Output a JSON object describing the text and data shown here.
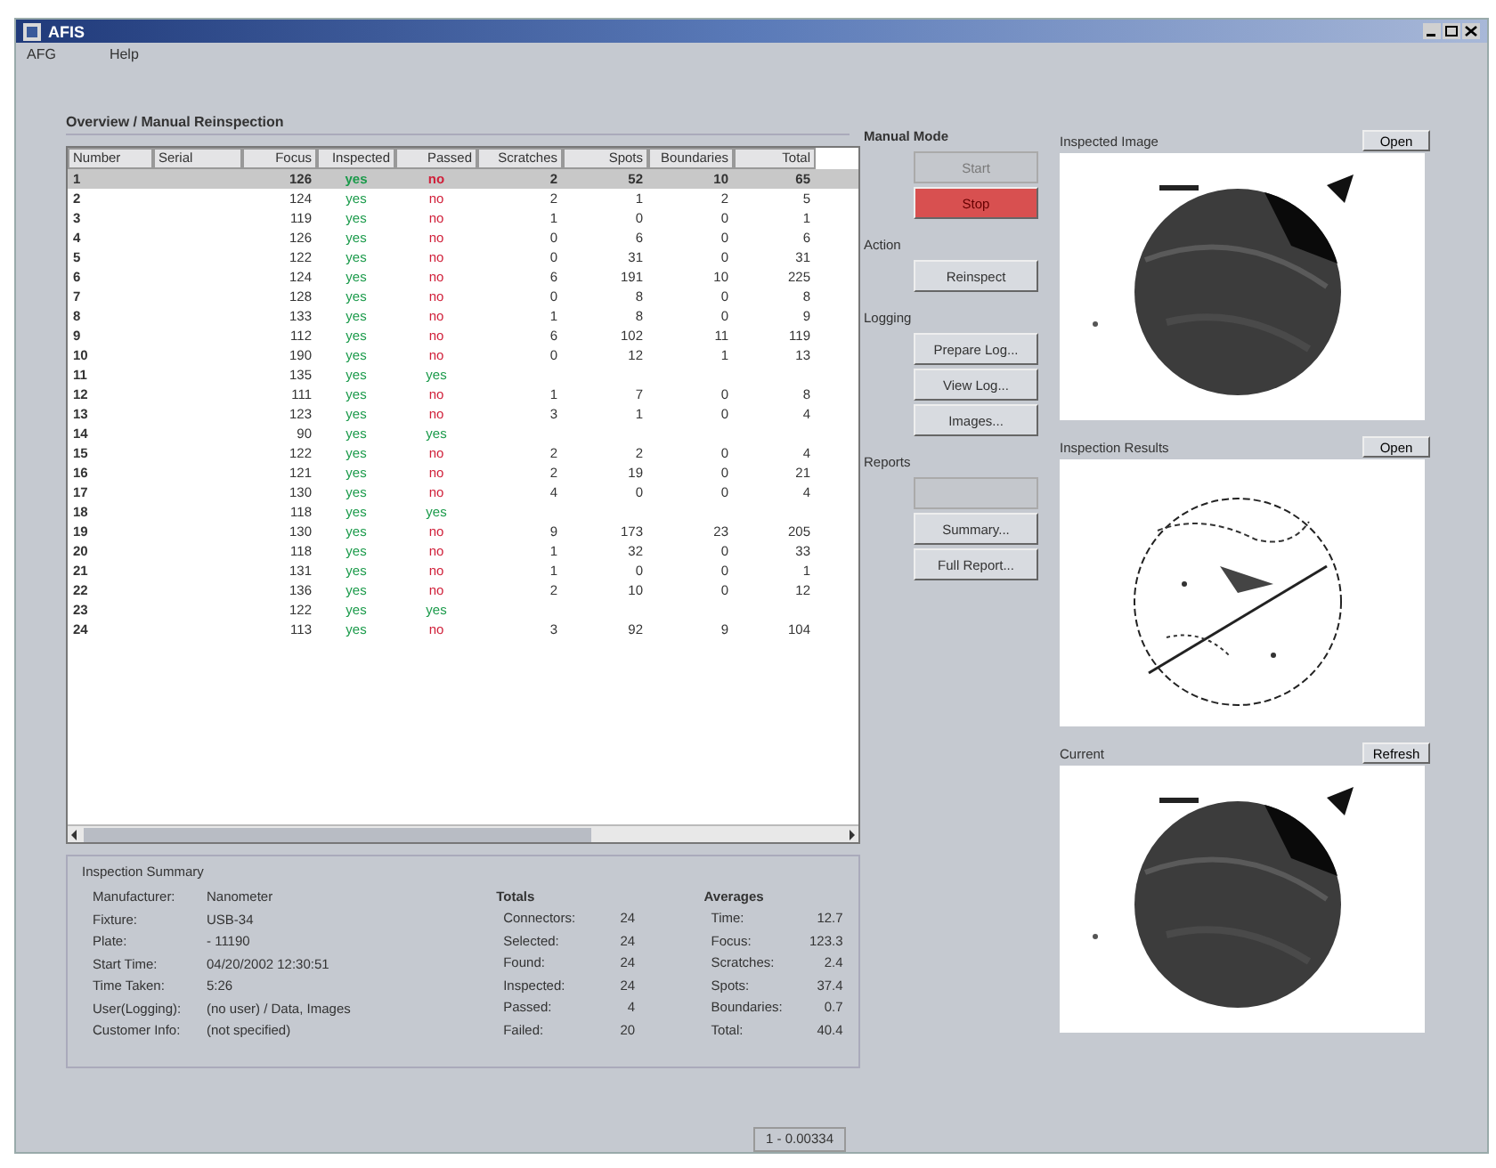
{
  "window": {
    "title": "AFIS"
  },
  "menu": [
    "AFG",
    "Help"
  ],
  "breadcrumb": "Overview / Manual Reinspection",
  "table": {
    "columns": [
      "Number",
      "Serial",
      "Focus",
      "Inspected",
      "Passed",
      "Scratches",
      "Spots",
      "Boundaries",
      "Total"
    ],
    "rows": [
      {
        "number": "1",
        "focus": "126",
        "inspected": {
          "text": "yes",
          "ok": true
        },
        "passed": {
          "text": "no",
          "ok": false
        },
        "scratches": "2",
        "spots": "52",
        "boundaries": "10",
        "total": "65",
        "selected": true
      },
      {
        "number": "2",
        "focus": "124",
        "inspected": {
          "text": "yes",
          "ok": true
        },
        "passed": {
          "text": "no",
          "ok": false
        },
        "scratches": "2",
        "spots": "1",
        "boundaries": "2",
        "total": "5",
        "selected": false
      },
      {
        "number": "3",
        "focus": "119",
        "inspected": {
          "text": "yes",
          "ok": true
        },
        "passed": {
          "text": "no",
          "ok": false
        },
        "scratches": "1",
        "spots": "0",
        "boundaries": "0",
        "total": "1",
        "selected": false
      },
      {
        "number": "4",
        "focus": "126",
        "inspected": {
          "text": "yes",
          "ok": true
        },
        "passed": {
          "text": "no",
          "ok": false
        },
        "scratches": "0",
        "spots": "6",
        "boundaries": "0",
        "total": "6",
        "selected": false
      },
      {
        "number": "5",
        "focus": "122",
        "inspected": {
          "text": "yes",
          "ok": true
        },
        "passed": {
          "text": "no",
          "ok": false
        },
        "scratches": "0",
        "spots": "31",
        "boundaries": "0",
        "total": "31",
        "selected": false
      },
      {
        "number": "6",
        "focus": "124",
        "inspected": {
          "text": "yes",
          "ok": true
        },
        "passed": {
          "text": "no",
          "ok": false
        },
        "scratches": "6",
        "spots": "191",
        "boundaries": "10",
        "total": "225",
        "selected": false
      },
      {
        "number": "7",
        "focus": "128",
        "inspected": {
          "text": "yes",
          "ok": true
        },
        "passed": {
          "text": "no",
          "ok": false
        },
        "scratches": "0",
        "spots": "8",
        "boundaries": "0",
        "total": "8",
        "selected": false
      },
      {
        "number": "8",
        "focus": "133",
        "inspected": {
          "text": "yes",
          "ok": true
        },
        "passed": {
          "text": "no",
          "ok": false
        },
        "scratches": "1",
        "spots": "8",
        "boundaries": "0",
        "total": "9",
        "selected": false
      },
      {
        "number": "9",
        "focus": "112",
        "inspected": {
          "text": "yes",
          "ok": true
        },
        "passed": {
          "text": "no",
          "ok": false
        },
        "scratches": "6",
        "spots": "102",
        "boundaries": "11",
        "total": "119",
        "selected": false
      },
      {
        "number": "10",
        "focus": "190",
        "inspected": {
          "text": "yes",
          "ok": true
        },
        "passed": {
          "text": "no",
          "ok": false
        },
        "scratches": "0",
        "spots": "12",
        "boundaries": "1",
        "total": "13",
        "selected": false
      },
      {
        "number": "11",
        "focus": "135",
        "inspected": {
          "text": "yes",
          "ok": true
        },
        "passed": {
          "text": "yes",
          "ok": true
        },
        "selected": false
      },
      {
        "number": "12",
        "focus": "111",
        "inspected": {
          "text": "yes",
          "ok": true
        },
        "passed": {
          "text": "no",
          "ok": false
        },
        "scratches": "1",
        "spots": "7",
        "boundaries": "0",
        "total": "8",
        "selected": false
      },
      {
        "number": "13",
        "focus": "123",
        "inspected": {
          "text": "yes",
          "ok": true
        },
        "passed": {
          "text": "no",
          "ok": false
        },
        "scratches": "3",
        "spots": "1",
        "boundaries": "0",
        "total": "4",
        "selected": false
      },
      {
        "number": "14",
        "focus": "90",
        "inspected": {
          "text": "yes",
          "ok": true
        },
        "passed": {
          "text": "yes",
          "ok": true
        },
        "selected": false
      },
      {
        "number": "15",
        "focus": "122",
        "inspected": {
          "text": "yes",
          "ok": true
        },
        "passed": {
          "text": "no",
          "ok": false
        },
        "scratches": "2",
        "spots": "2",
        "boundaries": "0",
        "total": "4",
        "selected": false
      },
      {
        "number": "16",
        "focus": "121",
        "inspected": {
          "text": "yes",
          "ok": true
        },
        "passed": {
          "text": "no",
          "ok": false
        },
        "scratches": "2",
        "spots": "19",
        "boundaries": "0",
        "total": "21",
        "selected": false
      },
      {
        "number": "17",
        "focus": "130",
        "inspected": {
          "text": "yes",
          "ok": true
        },
        "passed": {
          "text": "no",
          "ok": false
        },
        "scratches": "4",
        "spots": "0",
        "boundaries": "0",
        "total": "4",
        "selected": false
      },
      {
        "number": "18",
        "focus": "118",
        "inspected": {
          "text": "yes",
          "ok": true
        },
        "passed": {
          "text": "yes",
          "ok": true
        },
        "selected": false
      },
      {
        "number": "19",
        "focus": "130",
        "inspected": {
          "text": "yes",
          "ok": true
        },
        "passed": {
          "text": "no",
          "ok": false
        },
        "scratches": "9",
        "spots": "173",
        "boundaries": "23",
        "total": "205",
        "selected": false
      },
      {
        "number": "20",
        "focus": "118",
        "inspected": {
          "text": "yes",
          "ok": true
        },
        "passed": {
          "text": "no",
          "ok": false
        },
        "scratches": "1",
        "spots": "32",
        "boundaries": "0",
        "total": "33",
        "selected": false
      },
      {
        "number": "21",
        "focus": "131",
        "inspected": {
          "text": "yes",
          "ok": true
        },
        "passed": {
          "text": "no",
          "ok": false
        },
        "scratches": "1",
        "spots": "0",
        "boundaries": "0",
        "total": "1",
        "selected": false
      },
      {
        "number": "22",
        "focus": "136",
        "inspected": {
          "text": "yes",
          "ok": true
        },
        "passed": {
          "text": "no",
          "ok": false
        },
        "scratches": "2",
        "spots": "10",
        "boundaries": "0",
        "total": "12",
        "selected": false
      },
      {
        "number": "23",
        "focus": "122",
        "inspected": {
          "text": "yes",
          "ok": true
        },
        "passed": {
          "text": "yes",
          "ok": true
        },
        "selected": false
      },
      {
        "number": "24",
        "focus": "113",
        "inspected": {
          "text": "yes",
          "ok": true
        },
        "passed": {
          "text": "no",
          "ok": false
        },
        "scratches": "3",
        "spots": "92",
        "boundaries": "9",
        "total": "104",
        "selected": false
      }
    ]
  },
  "controls": [
    {
      "title": "Manual Mode",
      "buttons": [
        {
          "label": "Start",
          "disabled": true,
          "highlighted": false
        },
        {
          "label": "Stop",
          "disabled": false,
          "highlighted": true
        }
      ]
    },
    {
      "title": "Action",
      "buttons": [
        {
          "label": "Reinspect",
          "disabled": false,
          "highlighted": false
        }
      ]
    },
    {
      "title": "Logging",
      "buttons": [
        {
          "label": "Prepare Log...",
          "disabled": false,
          "highlighted": false
        },
        {
          "label": "View Log...",
          "disabled": false,
          "highlighted": false
        },
        {
          "label": "Images...",
          "disabled": false,
          "highlighted": false
        }
      ]
    },
    {
      "title": "Reports",
      "buttons": [
        {
          "disabled": true,
          "highlighted": false
        },
        {
          "label": "Summary...",
          "disabled": false,
          "highlighted": false
        },
        {
          "label": "Full Report...",
          "disabled": false,
          "highlighted": false
        }
      ]
    }
  ],
  "images": [
    {
      "title": "Inspected Image",
      "button": "Open",
      "kind": "wafer"
    },
    {
      "title": "Inspection Results",
      "button": "Open",
      "kind": "outline"
    },
    {
      "title": "Current",
      "button": "Refresh",
      "kind": "wafer"
    }
  ],
  "summary": {
    "title": "Inspection Summary",
    "info": [
      {
        "label": "Manufacturer:",
        "value": "Nanometer"
      },
      {
        "label": "Fixture:",
        "value": "USB-34"
      },
      {
        "label": "Plate:",
        "value": "- 11190"
      },
      {
        "label": "Start Time:",
        "value": "04/20/2002 12:30:51"
      },
      {
        "label": "Time Taken:",
        "value": "5:26"
      },
      {
        "label": "User(Logging):",
        "value": "(no user) / Data, Images"
      },
      {
        "label": "Customer Info:",
        "value": "(not specified)"
      }
    ],
    "totals_title": "Totals",
    "totals": [
      {
        "label": "Connectors:",
        "value": "24"
      },
      {
        "label": "Selected:",
        "value": "24"
      },
      {
        "label": "Found:",
        "value": "24"
      },
      {
        "label": "Inspected:",
        "value": "24"
      },
      {
        "label": "Passed:",
        "value": "4"
      },
      {
        "label": "Failed:",
        "value": "20"
      }
    ],
    "averages_title": "Averages",
    "averages": [
      {
        "label": "Time:",
        "value": "12.7"
      },
      {
        "label": "Focus:",
        "value": "123.3"
      },
      {
        "label": "Scratches:",
        "value": "2.4"
      },
      {
        "label": "Spots:",
        "value": "37.4"
      },
      {
        "label": "Boundaries:",
        "value": "0.7"
      },
      {
        "label": "Total:",
        "value": "40.4"
      }
    ]
  },
  "status_bar": [
    "1 - 0.00334"
  ]
}
